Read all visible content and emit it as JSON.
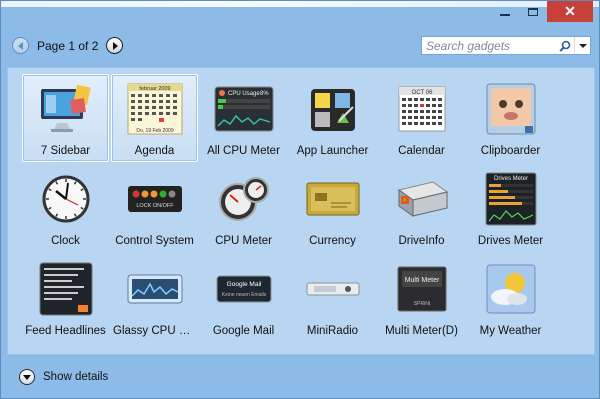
{
  "window": {
    "captions": {
      "minimize": "",
      "maximize": "",
      "close": "✕"
    }
  },
  "toolbar": {
    "page_label": "Page 1 of 2",
    "search_placeholder": "Search gadgets"
  },
  "gadgets": [
    {
      "label": "7 Sidebar",
      "icon": "monitor-icon",
      "selected": true
    },
    {
      "label": "Agenda",
      "icon": "agenda-calendar-icon",
      "selected": true
    },
    {
      "label": "All CPU Meter",
      "icon": "cpu-usage-panel-icon"
    },
    {
      "label": "App Launcher",
      "icon": "app-launcher-icon"
    },
    {
      "label": "Calendar",
      "icon": "calendar-icon"
    },
    {
      "label": "Clipboarder",
      "icon": "baby-photo-icon"
    },
    {
      "label": "Clock",
      "icon": "clock-icon"
    },
    {
      "label": "Control System",
      "icon": "control-buttons-icon"
    },
    {
      "label": "CPU Meter",
      "icon": "gauges-icon"
    },
    {
      "label": "Currency",
      "icon": "currency-card-icon"
    },
    {
      "label": "DriveInfo",
      "icon": "hard-drive-icon"
    },
    {
      "label": "Drives Meter",
      "icon": "drives-meter-panel-icon"
    },
    {
      "label": "Feed Headlines",
      "icon": "feed-panel-icon"
    },
    {
      "label": "Glassy CPU Mo...",
      "icon": "cpu-graph-icon"
    },
    {
      "label": "Google Mail",
      "icon": "mail-panel-icon"
    },
    {
      "label": "MiniRadio",
      "icon": "radio-icon"
    },
    {
      "label": "Multi Meter(D)",
      "icon": "multi-meter-icon"
    },
    {
      "label": "My Weather",
      "icon": "weather-icon"
    }
  ],
  "icon_text": {
    "agenda_header": "februar 2009",
    "agenda_footer": "Do, 19 Feb 2009",
    "cpu_title": "CPU Usage",
    "cpu_percent": "8%",
    "calendar_header": "OCT 06",
    "control_text": "LOCK ON/OFF",
    "drives_title": "Drives Meter",
    "mail_title": "Google Mail",
    "mail_sub": "Keine neuen Emails",
    "multi_title": "Multi Meter",
    "multi_sub": "SPRiNt"
  },
  "footer": {
    "show_details": "Show details"
  }
}
